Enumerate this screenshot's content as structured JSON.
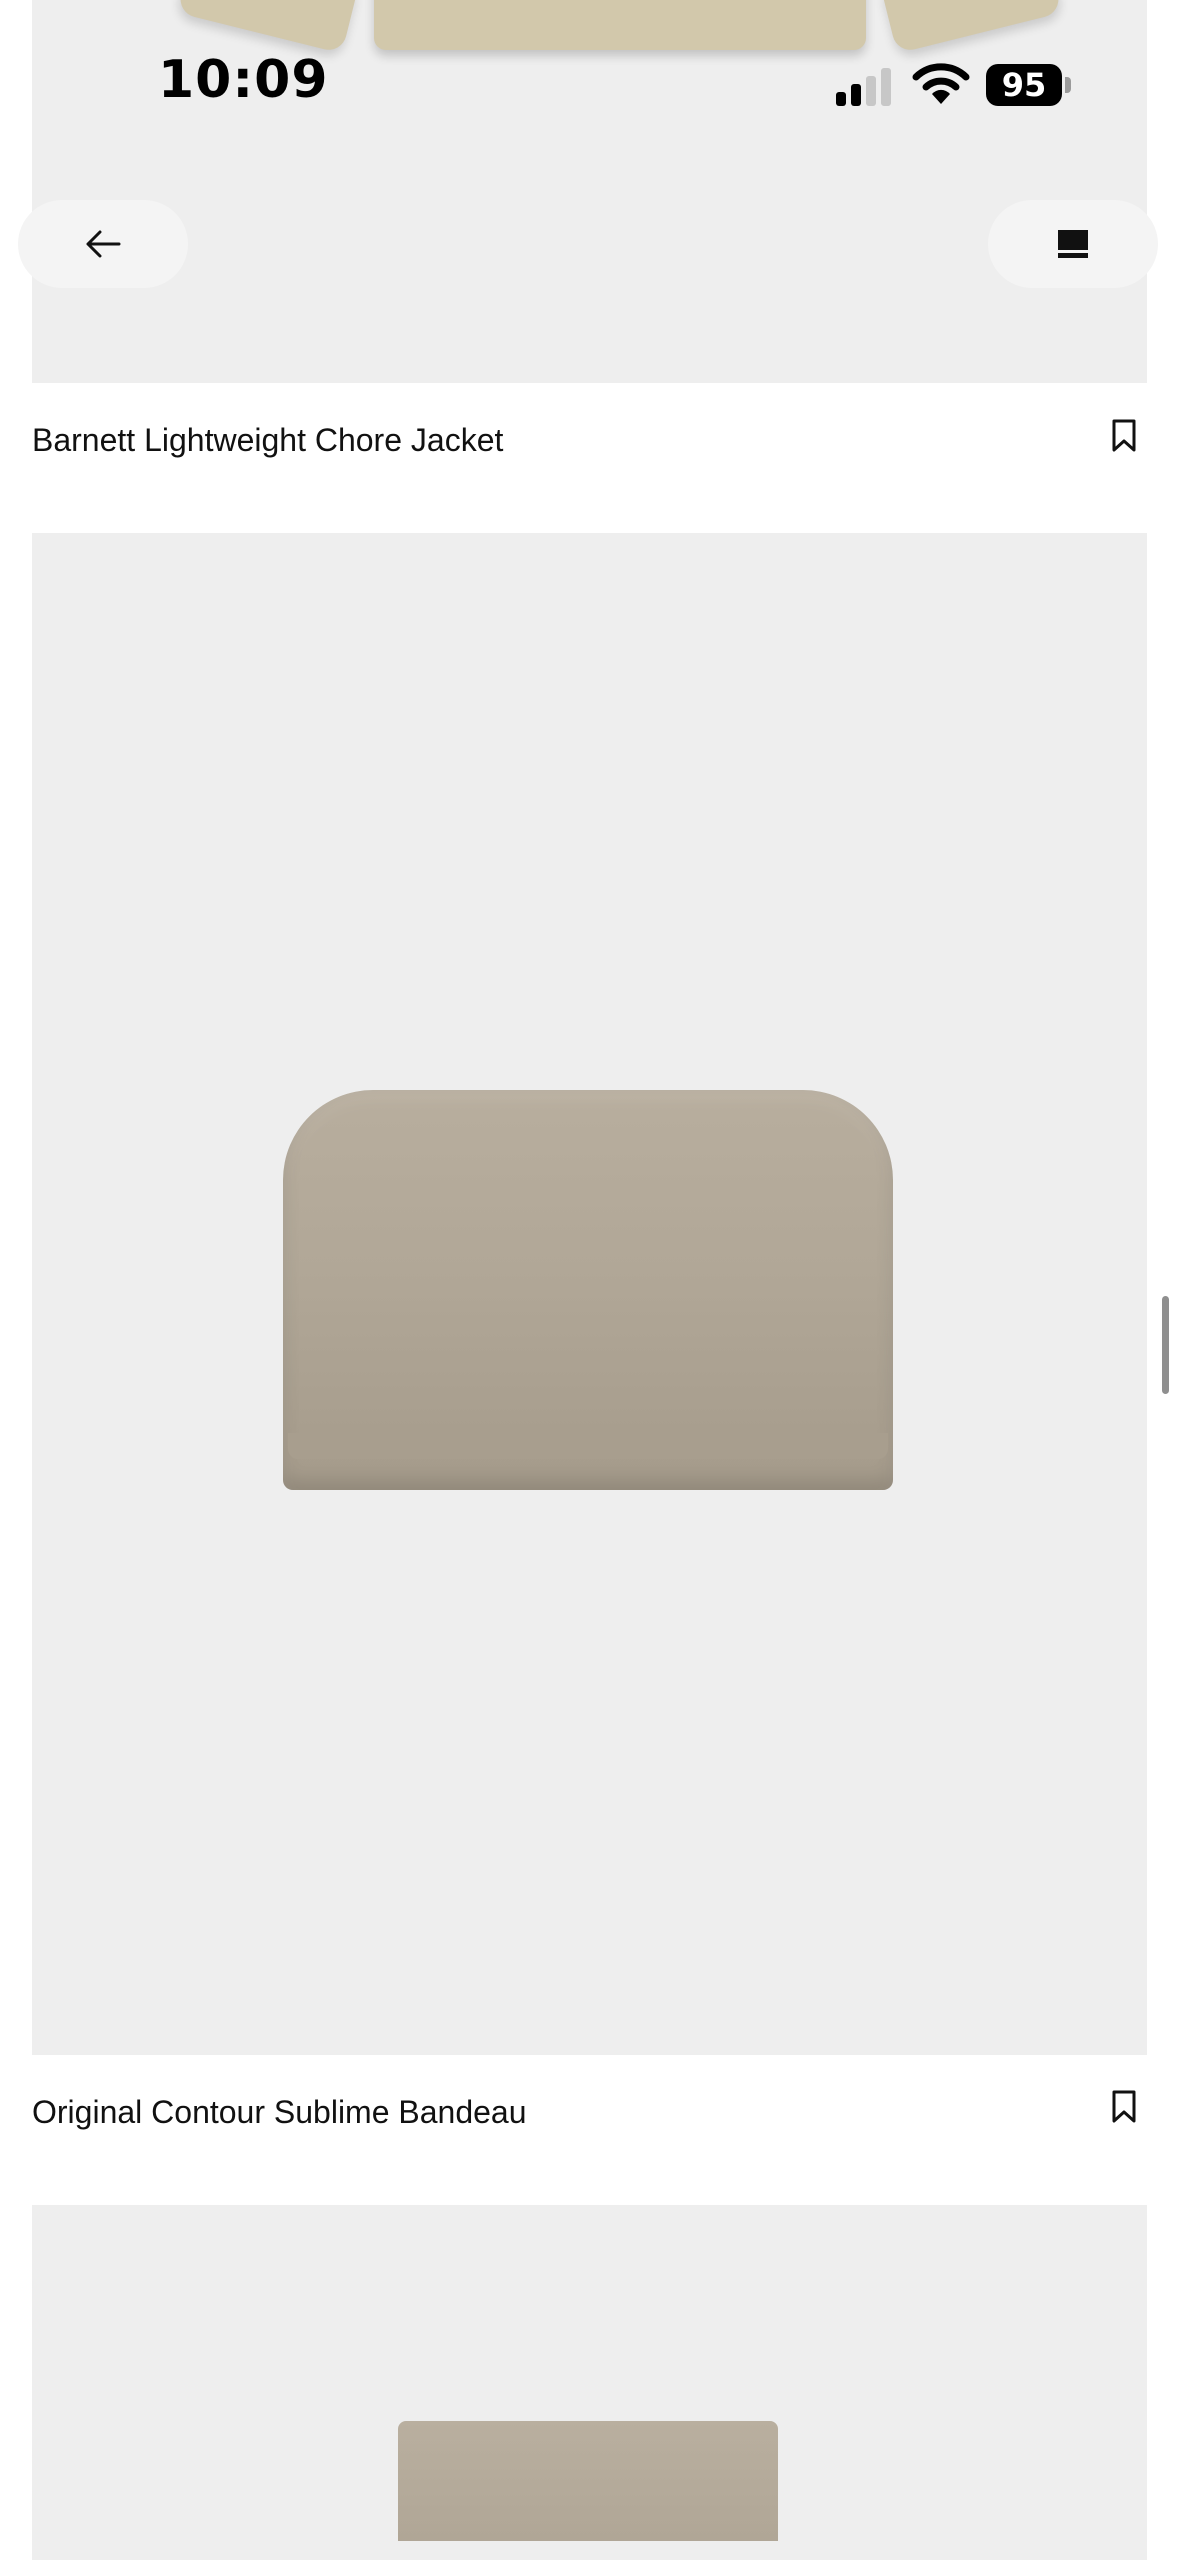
{
  "status_bar": {
    "time": "10:09",
    "battery": "95"
  },
  "nav": {
    "back_icon": "arrow-left-icon",
    "view_icon": "square-view-icon"
  },
  "products": [
    {
      "title": "Barnett Lightweight Chore Jacket",
      "bookmark_icon": "bookmark-icon"
    },
    {
      "title": "Original Contour Sublime Bandeau",
      "bookmark_icon": "bookmark-icon"
    }
  ],
  "colors": {
    "image_bg": "#eeeeee",
    "garment": "#b1a797",
    "jacket": "#d2c8ab"
  }
}
